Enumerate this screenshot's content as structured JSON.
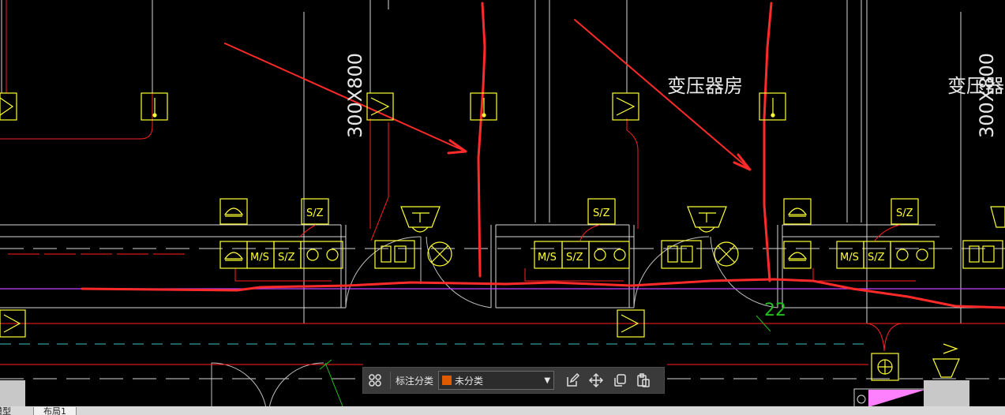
{
  "drawing": {
    "labels": {
      "duct_size": "300X800",
      "room_transformer": "变压器房",
      "dim_22": "22"
    },
    "symbol_text": {
      "sz": "S/Z",
      "ms": "M/S"
    },
    "colors": {
      "background": "#000000",
      "wall": "#d8d8d8",
      "device": "#ffff33",
      "redline": "#ff2020",
      "magenta": "#c040ff",
      "cyan": "#40c0c0",
      "green": "#20c020"
    }
  },
  "toolbar": {
    "grid_icon": "grid-icon",
    "category_label": "标注分类",
    "category_value": "未分类",
    "category_color": "#e05a00",
    "edit_icon": "edit-icon",
    "move_icon": "move-icon",
    "copy_icon": "copy-icon",
    "paste_icon": "paste-icon"
  },
  "tabs": {
    "model": "模型",
    "layout1": "布局1"
  }
}
